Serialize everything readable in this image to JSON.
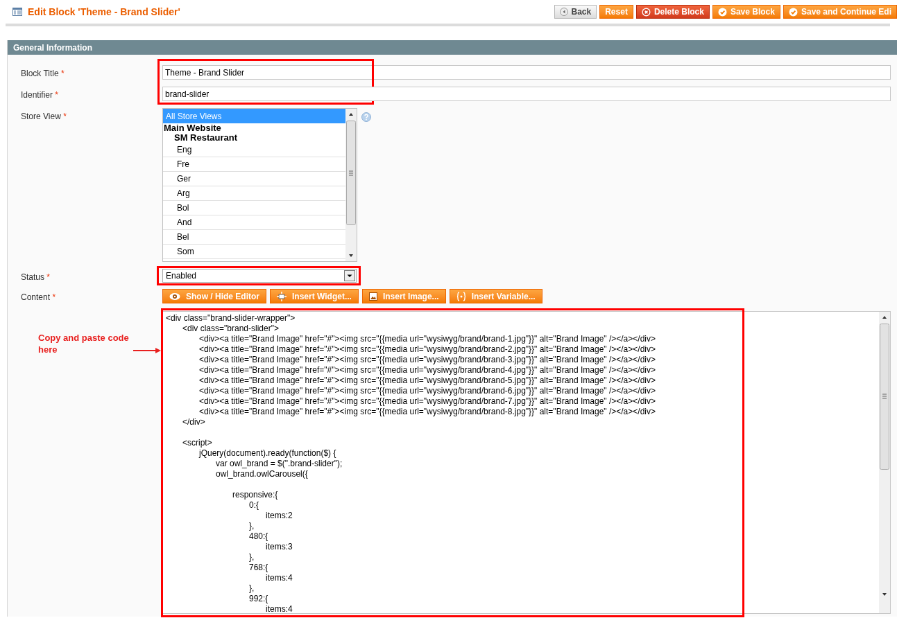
{
  "header": {
    "title": "Edit Block 'Theme - Brand Slider'",
    "buttons": [
      {
        "label": "Back",
        "kind": "back"
      },
      {
        "label": "Reset",
        "kind": "plain"
      },
      {
        "label": "Delete Block",
        "kind": "delete"
      },
      {
        "label": "Save Block",
        "kind": "save"
      },
      {
        "label": "Save and Continue Edi",
        "kind": "save"
      }
    ]
  },
  "section": {
    "title": "General Information"
  },
  "fields": [
    {
      "label": "Block Title",
      "required": "*",
      "kind": "text",
      "value": "Theme - Brand Slider",
      "annotated": true
    },
    {
      "label": "Identifier",
      "required": "*",
      "kind": "text",
      "value": "brand-slider",
      "annotated": true
    },
    {
      "label": "Store View",
      "required": "*",
      "kind": "multiselect",
      "options": [
        {
          "label": "All Store Views",
          "selected": true
        },
        {
          "label": "Main Website",
          "children": [
            {
              "label": "SM Restaurant",
              "children": [
                {
                  "label": "Eng",
                  "selected": false
                },
                {
                  "label": "Fre",
                  "selected": false
                },
                {
                  "label": "Ger",
                  "selected": false
                },
                {
                  "label": "Arg",
                  "selected": false
                },
                {
                  "label": "Bol",
                  "selected": false
                },
                {
                  "label": "And",
                  "selected": false
                },
                {
                  "label": "Bel",
                  "selected": false
                },
                {
                  "label": "Som",
                  "selected": false
                }
              ]
            }
          ]
        }
      ]
    },
    {
      "label": "Status",
      "required": "*",
      "kind": "select",
      "value": "Enabled",
      "annotated": true
    },
    {
      "label": "Content",
      "required": "*",
      "kind": "editor",
      "buttons": [
        {
          "label": "Show / Hide Editor"
        },
        {
          "label": "Insert Widget..."
        },
        {
          "label": "Insert Image..."
        },
        {
          "label": "Insert Variable..."
        }
      ],
      "value": "<div class=\"brand-slider-wrapper\">\n\t<div class=\"brand-slider\">\n\t\t<div><a title=\"Brand Image\" href=\"#\"><img src=\"{{media url=\"wysiwyg/brand/brand-1.jpg\"}}\" alt=\"Brand Image\" /></a></div>\n\t\t<div><a title=\"Brand Image\" href=\"#\"><img src=\"{{media url=\"wysiwyg/brand/brand-2.jpg\"}}\" alt=\"Brand Image\" /></a></div>\n\t\t<div><a title=\"Brand Image\" href=\"#\"><img src=\"{{media url=\"wysiwyg/brand/brand-3.jpg\"}}\" alt=\"Brand Image\" /></a></div>\n\t\t<div><a title=\"Brand Image\" href=\"#\"><img src=\"{{media url=\"wysiwyg/brand/brand-4.jpg\"}}\" alt=\"Brand Image\" /></a></div>\n\t\t<div><a title=\"Brand Image\" href=\"#\"><img src=\"{{media url=\"wysiwyg/brand/brand-5.jpg\"}}\" alt=\"Brand Image\" /></a></div>\n\t\t<div><a title=\"Brand Image\" href=\"#\"><img src=\"{{media url=\"wysiwyg/brand/brand-6.jpg\"}}\" alt=\"Brand Image\" /></a></div>\n\t\t<div><a title=\"Brand Image\" href=\"#\"><img src=\"{{media url=\"wysiwyg/brand/brand-7.jpg\"}}\" alt=\"Brand Image\" /></a></div>\n\t\t<div><a title=\"Brand Image\" href=\"#\"><img src=\"{{media url=\"wysiwyg/brand/brand-8.jpg\"}}\" alt=\"Brand Image\" /></a></div>\n\t</div>\n\n\t<script>\n\t\tjQuery(document).ready(function($) {\n\t\t\tvar owl_brand = $(\".brand-slider\");\n\t\t\towl_brand.owlCarousel({\n\n\t\t\t\tresponsive:{\n\t\t\t\t\t0:{\n\t\t\t\t\t\titems:2\n\t\t\t\t\t},\n\t\t\t\t\t480:{\n\t\t\t\t\t\titems:3\n\t\t\t\t\t},\n\t\t\t\t\t768:{\n\t\t\t\t\t\titems:4\n\t\t\t\t\t},\n\t\t\t\t\t992:{\n\t\t\t\t\t\titems:4",
      "annotated": true
    }
  ],
  "annotation": {
    "text": "Copy and paste code here"
  }
}
